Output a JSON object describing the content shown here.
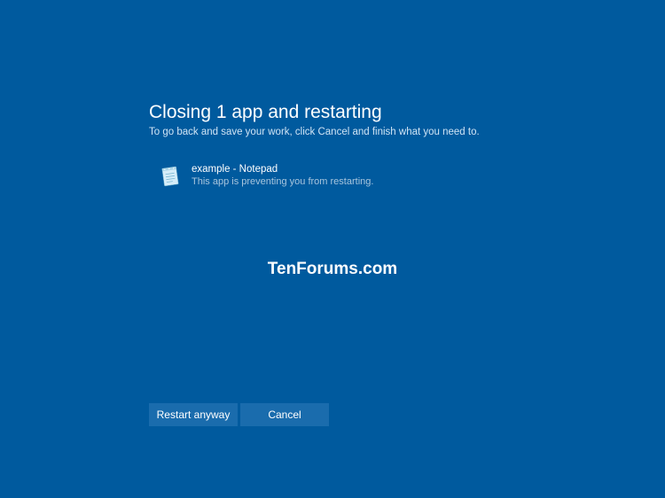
{
  "dialog": {
    "title": "Closing 1 app and restarting",
    "subtitle": "To go back and save your work, click Cancel and finish what you need to.",
    "apps": [
      {
        "name": "example - Notepad",
        "status": "This app is preventing you from restarting."
      }
    ],
    "buttons": {
      "restart": "Restart anyway",
      "cancel": "Cancel"
    }
  },
  "watermark": "TenForums.com"
}
